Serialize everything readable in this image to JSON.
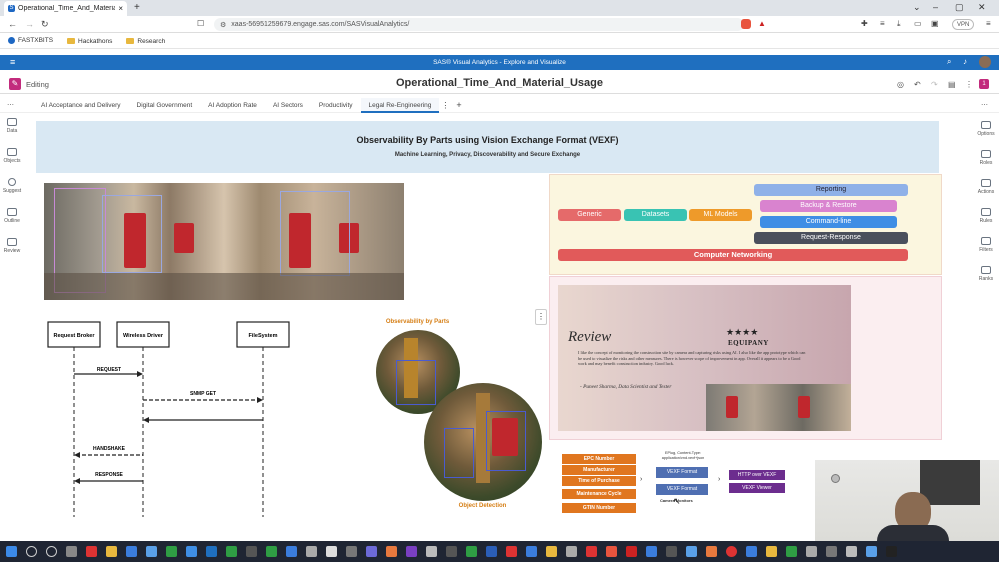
{
  "browser": {
    "tab_title": "Operational_Time_And_Material_",
    "tab_close": "×",
    "new_tab": "+",
    "url": "xaas-56951259679.engage.sas.com/SASVisualAnalytics/",
    "vpn_label": "VPN",
    "bookmarks": [
      "FASTXBITS",
      "Hackathons",
      "Research"
    ]
  },
  "sas": {
    "app_title": "SAS® Visual Analytics - Explore and Visualize",
    "mode_label": "Editing",
    "report_title": "Operational_Time_And_Material_Usage",
    "page_tabs": [
      "AI Acceptance and Delivery",
      "Digital Government",
      "AI Adoption Rate",
      "AI Sectors",
      "Productivity",
      "Legal Re-Engineering"
    ],
    "active_tab": "Legal Re-Engineering",
    "left_sidebar": [
      "Data",
      "Objects",
      "Suggest",
      "Outline",
      "Review"
    ],
    "right_sidebar": [
      "Options",
      "Roles",
      "Actions",
      "Rules",
      "Filters",
      "Ranks"
    ]
  },
  "report": {
    "title": "Observability By Parts using Vision Exchange Format (VEXF)",
    "subtitle": "Machine Learning, Privacy, Discoverability and Secure Exchange",
    "sequence": {
      "actors": [
        "Request Broker",
        "Wireless Driver",
        "FileSystem"
      ],
      "messages": [
        "REQUEST",
        "SNMP GET",
        "HANDSHAKE",
        "RESPONSE"
      ]
    },
    "observability_title": "Observability by Parts",
    "object_detection_label": "Object Detection",
    "chips": {
      "generic": "Generic",
      "datasets": "Datasets",
      "ml_models": "ML Models",
      "reporting": "Reporting",
      "backup": "Backup & Restore",
      "command_line": "Command-line",
      "request_response": "Request-Response",
      "computer_networking": "Computer Networking"
    },
    "review": {
      "heading": "Review",
      "stars": "★★★★",
      "company": "EQUIPANY",
      "body": "I like the concept of monitoring the construction site by camera and capturing risks using AI. I also like the app prototype which can be used to visualize the risks and other measures. There is however scope of improvement in app. Overall it appears to be a Good work and may benefit construction industry. Good luck.",
      "author": "- Puneet Sharma, Data Scientist and Tester"
    },
    "epc_table": [
      "EPC Number",
      "Manufacturer",
      "Time of Purchase",
      "Maintenance Cycle",
      "GTIN Number"
    ],
    "vexf_note": "EPlug, Content-Type: application/vnd.vexf+json",
    "vexf_boxes": [
      "VEXF Format",
      "VEXF Format"
    ],
    "vexf_out": [
      "HTTP over VEXF",
      "VEXF Viewer"
    ],
    "camera_label": "Camera Monitors"
  },
  "colors": {
    "sas_blue": "#1f6fbf",
    "edit_pink": "#c22b7d",
    "generic": "#e56a6a",
    "datasets": "#39c3b3",
    "ml_models": "#ee9a2a",
    "reporting": "#8fb1e8",
    "backup": "#d983cf",
    "command_line": "#3f8ee5",
    "request_response": "#4a4f5c",
    "computer_networking": "#e15a5a"
  }
}
